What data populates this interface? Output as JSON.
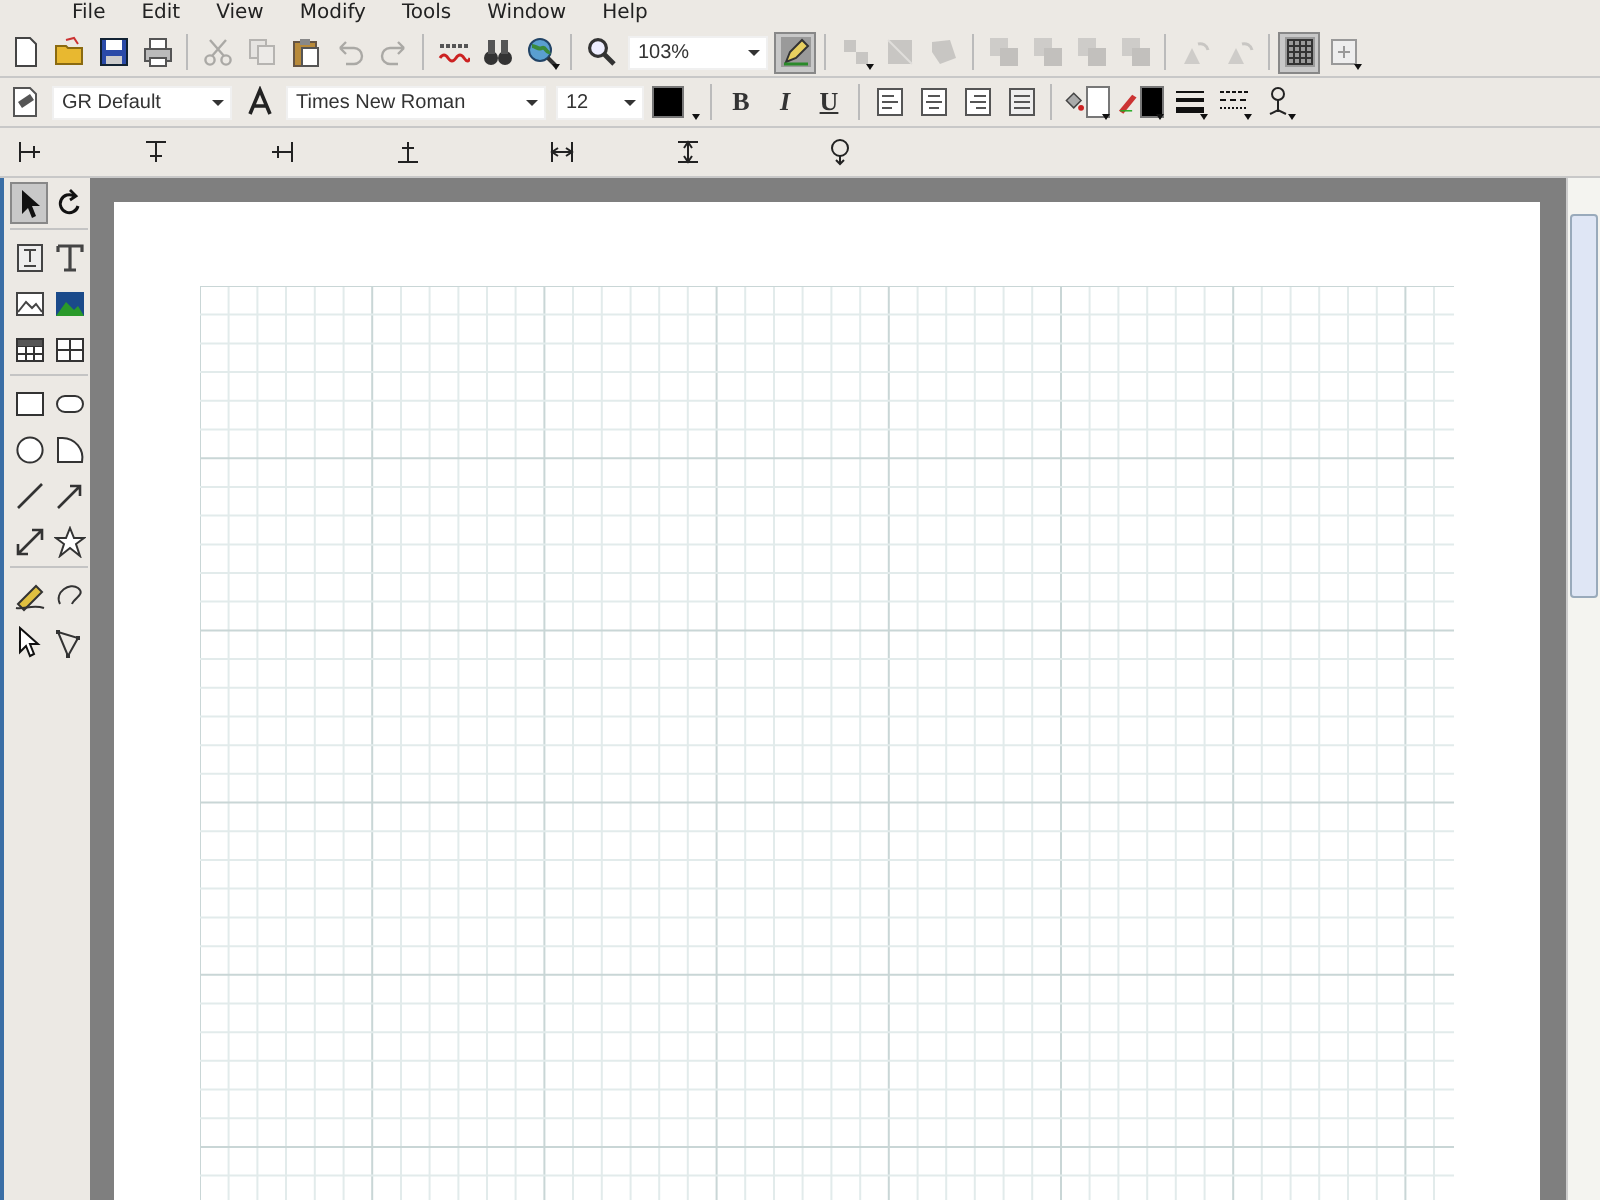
{
  "menu_bar": [
    "File",
    "Edit",
    "View",
    "Modify",
    "Tools",
    "Window",
    "Help"
  ],
  "standard_toolbar": [
    {
      "disabled": false
    },
    {
      "disabled": false
    },
    {
      "disabled": false
    },
    {
      "disabled": false
    },
    {
      "disabled": true
    },
    {
      "disabled": true
    },
    {
      "disabled": false
    },
    {
      "disabled": true
    },
    {
      "disabled": true
    },
    {
      "disabled": false
    },
    {
      "disabled": false
    },
    {
      "disabled": false
    },
    {
      "disabled": false
    }
  ],
  "zoom": {
    "value": "103%"
  },
  "standard_toolbar_2": [
    {
      "disabled": false,
      "pressed": true
    },
    {
      "disabled": true,
      "pressed": false
    },
    {
      "disabled": true,
      "pressed": false
    },
    {
      "disabled": true,
      "pressed": false
    },
    {
      "disabled": true,
      "pressed": false
    },
    {
      "disabled": true,
      "pressed": false
    },
    {
      "disabled": true,
      "pressed": false
    },
    {
      "disabled": true,
      "pressed": false
    },
    {
      "disabled": true,
      "pressed": false
    },
    {
      "disabled": true,
      "pressed": false
    },
    {
      "disabled": false,
      "pressed": true
    },
    {
      "disabled": false,
      "pressed": false
    }
  ],
  "format_toolbar": {
    "style": "GR Default",
    "font": "Times New Roman",
    "size": "12",
    "bold": {
      "label": "B",
      "pressed": false
    },
    "italic": {
      "label": "I",
      "pressed": false
    },
    "underline": {
      "label": "U",
      "pressed": false
    }
  },
  "tool_palette": [
    {
      "selected": true
    },
    {
      "selected": false
    },
    {
      "selected": false
    },
    {
      "selected": false
    },
    {
      "selected": false
    },
    {
      "selected": false
    },
    {
      "selected": false
    },
    {
      "selected": false
    },
    {
      "selected": false
    },
    {
      "selected": false
    },
    {
      "selected": false
    },
    {
      "selected": false
    },
    {
      "selected": false
    },
    {
      "selected": false
    },
    {
      "selected": false
    },
    {
      "selected": false
    },
    {
      "selected": false
    },
    {
      "selected": false
    },
    {
      "selected": false
    },
    {
      "selected": false
    }
  ]
}
